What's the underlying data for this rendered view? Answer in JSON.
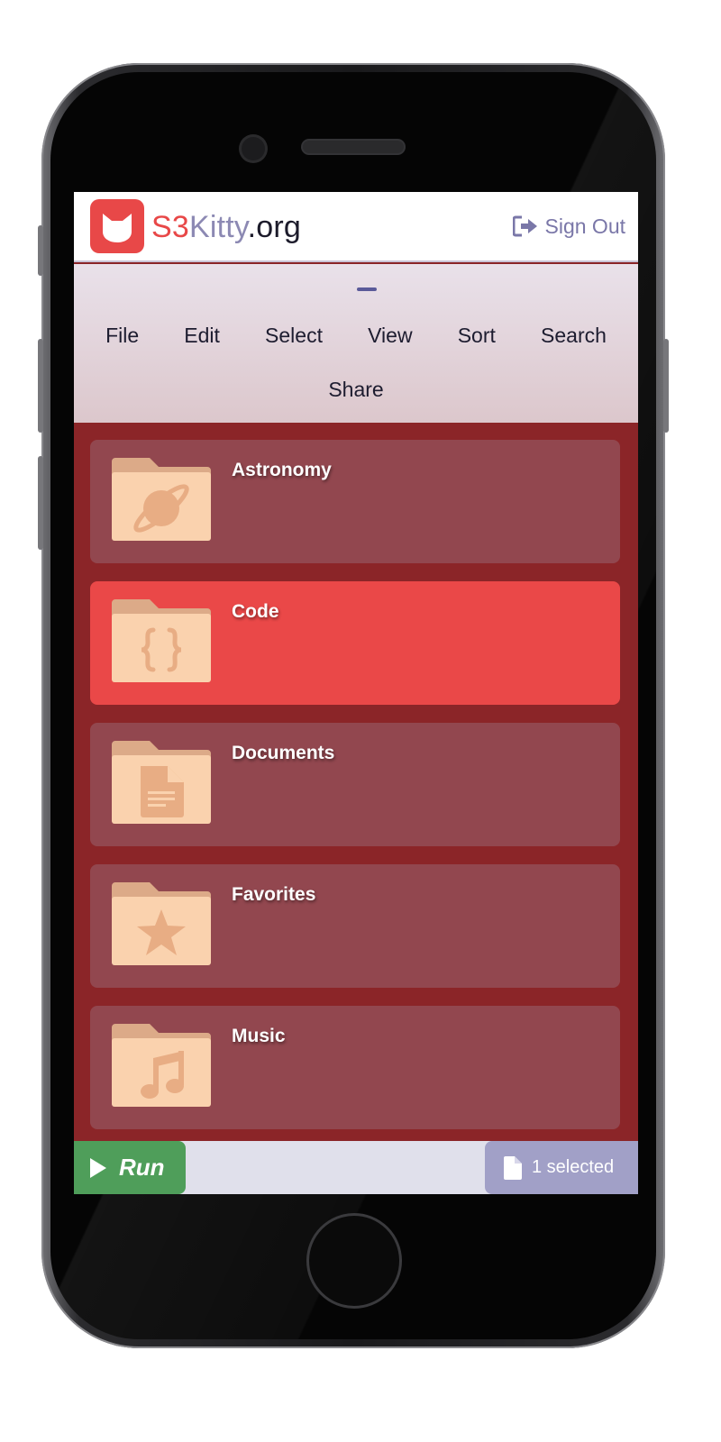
{
  "header": {
    "brand_s3": "S3",
    "brand_kitty": "Kitty",
    "brand_org": ".org",
    "signout_label": "Sign Out"
  },
  "menu": {
    "items": [
      "File",
      "Edit",
      "Select",
      "View",
      "Sort",
      "Search",
      "Share"
    ]
  },
  "folders": [
    {
      "name": "Astronomy",
      "icon": "planet-icon",
      "selected": false
    },
    {
      "name": "Code",
      "icon": "braces-icon",
      "selected": true
    },
    {
      "name": "Documents",
      "icon": "document-icon",
      "selected": false
    },
    {
      "name": "Favorites",
      "icon": "star-icon",
      "selected": false
    },
    {
      "name": "Music",
      "icon": "music-note-icon",
      "selected": false
    }
  ],
  "footer": {
    "run_label": "Run",
    "selected_label": "1 selected"
  },
  "colors": {
    "brand_red": "#e84848",
    "brand_purple": "#8c89b3",
    "list_background": "#8b2528",
    "folder_card": "#92474f",
    "folder_card_selected": "#ea4848",
    "run_green": "#4f9e5a",
    "selected_purple": "#a1a0c7"
  }
}
